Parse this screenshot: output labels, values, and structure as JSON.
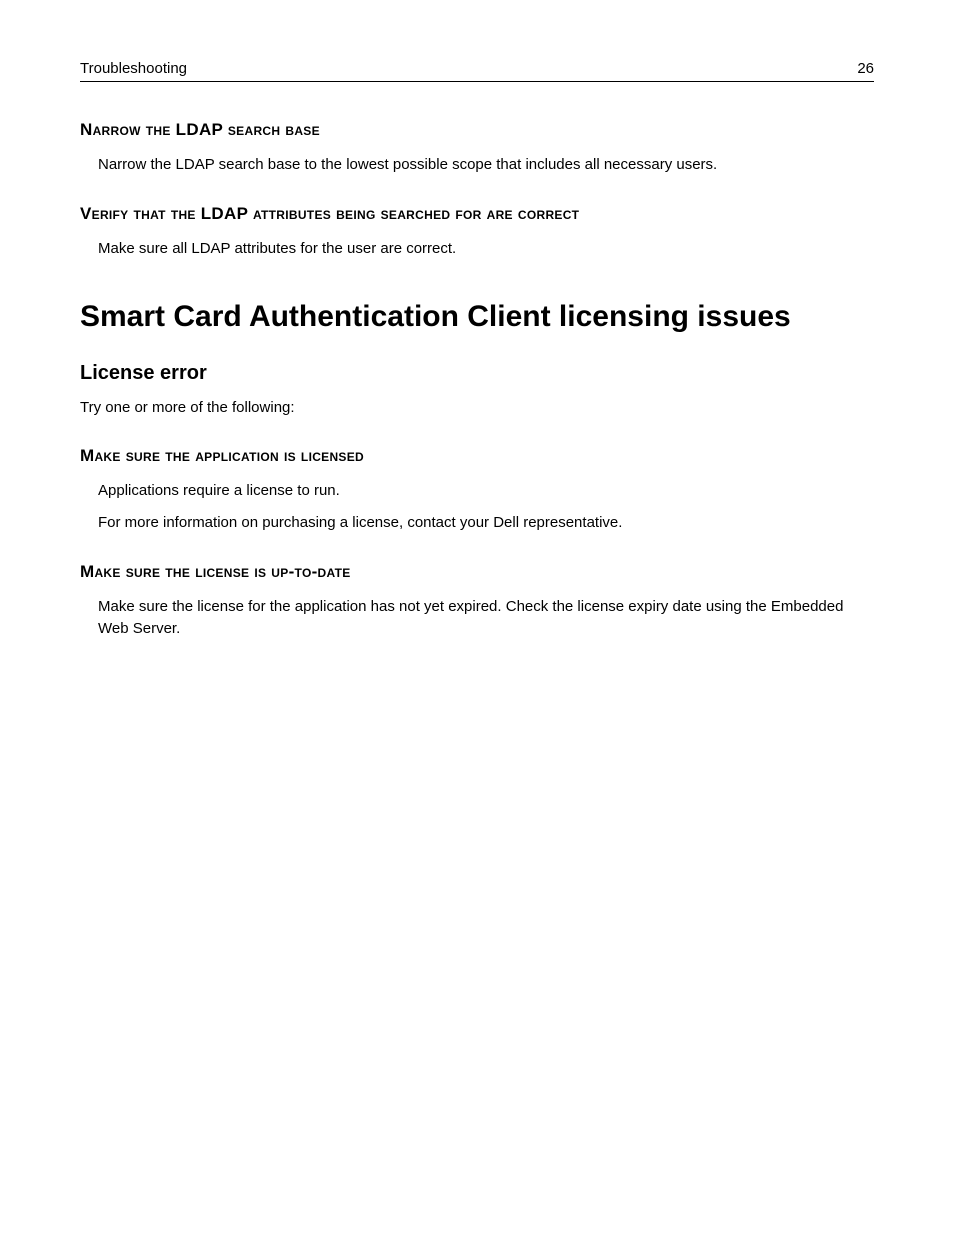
{
  "header": {
    "section": "Troubleshooting",
    "page_number": "26"
  },
  "ldap_narrow": {
    "heading": "Narrow the LDAP search base",
    "body": "Narrow the LDAP search base to the lowest possible scope that includes all necessary users."
  },
  "ldap_verify": {
    "heading": "Verify that the LDAP attributes being searched for are correct",
    "body": "Make sure all LDAP attributes for the user are correct."
  },
  "main_title": "Smart Card Authentication Client licensing issues",
  "license_error": {
    "heading": "License error",
    "intro": "Try one or more of the following:"
  },
  "app_licensed": {
    "heading": "Make sure the application is licensed",
    "body1": "Applications require a license to run.",
    "body2": "For more information on purchasing a license, contact your Dell representative."
  },
  "license_uptodate": {
    "heading": "Make sure the license is up-to-date",
    "body": "Make sure the license for the application has not yet expired. Check the license expiry date using the Embedded Web Server."
  }
}
